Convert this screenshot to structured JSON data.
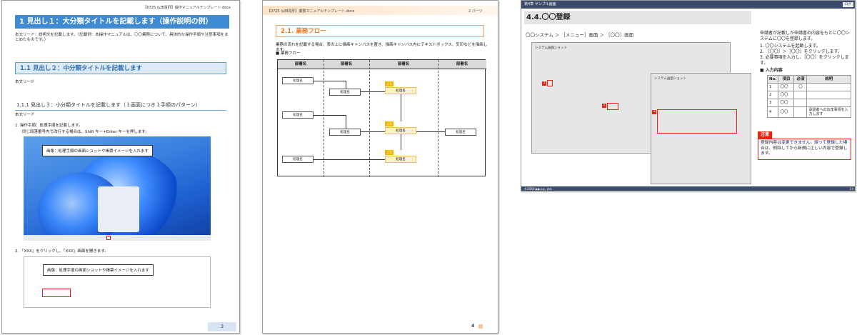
{
  "page1": {
    "header": "【0725 仏田買肝】操作マニュアルテンプレート.docx",
    "h1": "1 見出し１：大分類タイトルを記載します（操作説明の例）",
    "h1_body": "本文リード：説明文を記載します。（記載例：本操作マニュアルは、〇〇業務について、具体的な操作手順や注意事項をまとめたものです。）",
    "h2": "1.1 見出し２：中分類タイトルを記載します",
    "h2_body": "本文リード",
    "h3": "1.1.1 見出し３：小分類タイトルを記載します（１画面につき１手順のパターン）",
    "h3_body": "本文リード",
    "step1": "1. 操作手順：処理手順を記載します。",
    "step1_sub": "同じ段落番号内で改行する場合は、Shift キー+Enter キーを押します。",
    "callout1": "画像：処理手順の画面ショットや帳票イメージを入れます",
    "step2": "2. 「XXX」をクリックし、「XXX」画面を開きます。",
    "callout2": "画像：処理手順の画面ショットや帳票イメージを入れます",
    "page_number": "3"
  },
  "page2": {
    "header_left": "【0725 仏田買肝】業務マニュアルテンプレート.docx",
    "header_right": "2 パーツ",
    "heading": "2.1. 業務フロー",
    "desc": "業務の流れを記載する場合、表の上に描画キャンバスを置き、描画キャンバス内にテキストボックス、矢印などを描画します。",
    "flow_label": "■ 業務フロー",
    "lanes": [
      "部署名",
      "部署名",
      "部署名",
      "部署名"
    ],
    "procs": [
      "処理名",
      "処理名",
      "処理名",
      "処理名",
      "処理名",
      "処理名",
      "処理名",
      "処理名",
      "処理名",
      "処理名"
    ],
    "nums": [
      "3.1",
      "3.2",
      "3.3"
    ],
    "page_number": "4"
  },
  "page3": {
    "topbar": "第4章 サンプル画面",
    "topbar_right": "ログ",
    "title": "4.4.〇〇登録",
    "breadcrumb": "〇〇システム ＞ ［メニュー］画面 ＞ ［〇〇］画面",
    "shotA_label": "システム画面ショット",
    "shotB_label": "システム画面ショット",
    "marks": [
      "1",
      "2",
      "3"
    ],
    "right_intro": "申請者が記載した申請書の内容をもとに〇〇システムに〇〇を登録します。",
    "steps": [
      "1. 〇〇システムを起動します。",
      "2. ［〇〇］＞［〇〇］をクリックします。",
      "3. 必要事項を入力し、［〇〇］をクリックします。"
    ],
    "input_label": "■ 入力内容",
    "table_headers": [
      "No.",
      "項目",
      "必須",
      "説明"
    ],
    "table_rows": [
      [
        "1",
        "〇〇",
        "〇",
        ""
      ],
      [
        "2",
        "〇〇",
        "",
        ""
      ],
      [
        "3",
        "〇〇",
        "",
        ""
      ],
      [
        "4",
        "〇〇",
        "",
        "承認者への伝達事項を入力します"
      ]
    ],
    "note_tag": "注意",
    "note": "登録内容は変更できません。誤って登録した場合は、削除してから新規に正しい内容で登録します。",
    "footer_left": "©2XXX ▶▶◎◎, Ltd.",
    "footer_right": "24"
  }
}
